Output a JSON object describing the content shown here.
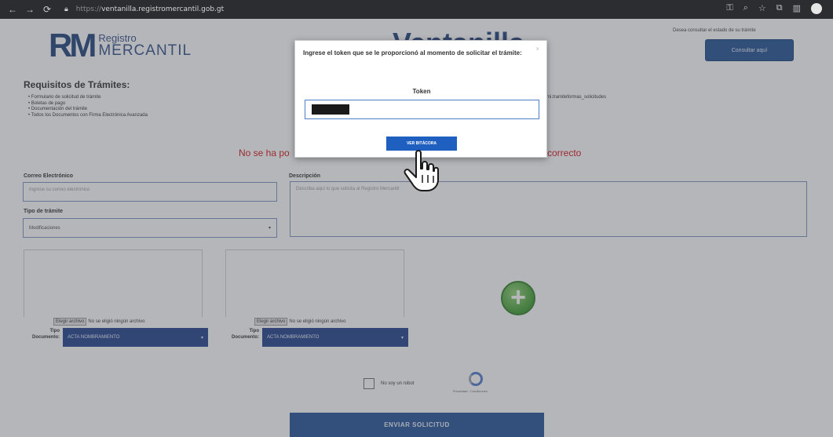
{
  "browser": {
    "url_scheme": "https://",
    "url_host": "ventanilla.registromercantil.gob.gt"
  },
  "header": {
    "logo_mark": "RM",
    "logo_line1": "Registro",
    "logo_line2": "MERCANTIL",
    "page_title": "Ventanilla",
    "consult_prompt": "Desea consultar el estado de su trámite",
    "consult_button": "Consultar aquí"
  },
  "requirements": {
    "title": "Requisitos de Trámites:",
    "items": [
      "Formulario de solicitud de trámite",
      "Boletas de pago",
      "Documentación del trámite",
      "Todos los Documentos con Firma Electrónica Avanzada"
    ],
    "side_note": "mi.tramiteformas_solicitudes"
  },
  "error": {
    "left": "No se ha po",
    "right": "correcto"
  },
  "form": {
    "email_label": "Correo Electrónico",
    "email_placeholder": "Ingrese su correo electrónico",
    "type_label": "Tipo de trámite",
    "type_value": "Modificaciones",
    "description_label": "Descripción",
    "description_placeholder": "Describa aquí lo que solicita al Registro Mercantil",
    "file_choose": "Elegir archivo",
    "file_none": "No se eligió ningún archivo",
    "doc_type_label": "Tipo Documento:",
    "doc_type_value": "ACTA NOMBRAMIENTO",
    "captcha_label": "No soy un robot",
    "captcha_sub": "Privacidad - Condiciones",
    "submit": "ENVIAR SOLICITUD"
  },
  "modal": {
    "message": "Ingrese el token que se le proporcionó al momento de solicitar el trámite:",
    "token_label": "Token",
    "verify_button": "VER BITÁCORA",
    "close_symbol": "×"
  },
  "colors": {
    "brand_blue": "#1e4f8f",
    "error_red": "#d20f0f",
    "add_green": "#3c9a2c"
  }
}
